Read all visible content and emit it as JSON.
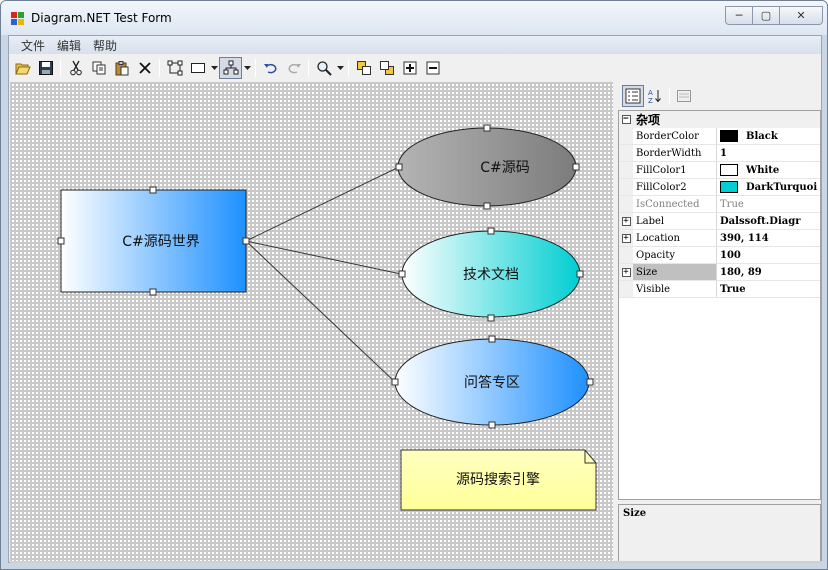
{
  "window": {
    "title": "Diagram.NET Test Form",
    "controls": {
      "minimize": "─",
      "maximize": "▢",
      "close": "✕"
    }
  },
  "menu": {
    "items": [
      "文件",
      "编辑",
      "帮助"
    ]
  },
  "toolbar": {
    "buttons": [
      {
        "icon": "open-folder-icon"
      },
      {
        "icon": "save-icon"
      },
      {
        "icon": "cut-icon"
      },
      {
        "icon": "copy-icon"
      },
      {
        "icon": "paste-icon"
      },
      {
        "icon": "delete-icon"
      },
      {
        "icon": "connector-tool-icon"
      },
      {
        "icon": "rectangle-tool-icon"
      },
      {
        "icon": "auto-layout-icon",
        "pressed": true
      },
      {
        "icon": "undo-icon"
      },
      {
        "icon": "redo-icon"
      },
      {
        "icon": "zoom-icon"
      },
      {
        "icon": "bring-to-front-icon"
      },
      {
        "icon": "send-to-back-icon"
      },
      {
        "icon": "add-icon"
      },
      {
        "icon": "remove-icon"
      }
    ]
  },
  "diagram": {
    "rectangle_label": "C#源码世界",
    "ellipse1_label": "C#源码",
    "ellipse2_label": "技术文档",
    "ellipse3_label": "问答专区",
    "note_label": "源码搜索引擎",
    "colors": {
      "rect_gradient": [
        "#ffffff",
        "#1e90ff"
      ],
      "ellipse1_gradient": [
        "#b4b4b4",
        "#7c7c7c"
      ],
      "ellipse2_gradient": [
        "#ffffff",
        "#00ced1"
      ],
      "ellipse3_gradient": [
        "#ffffff",
        "#1e90ff"
      ],
      "note_gradient": [
        "#ffffc0",
        "#ffff99"
      ]
    }
  },
  "property_grid": {
    "category": "杂项",
    "rows": [
      {
        "name": "BorderColor",
        "value": "Black",
        "swatch": "#000000"
      },
      {
        "name": "BorderWidth",
        "value": "1"
      },
      {
        "name": "FillColor1",
        "value": "White",
        "swatch": "#ffffff"
      },
      {
        "name": "FillColor2",
        "value": "DarkTurquoi",
        "swatch": "#00ced1"
      },
      {
        "name": "IsConnected",
        "value": "True",
        "dim": true
      },
      {
        "name": "Label",
        "value": "Dalssoft.Diagr",
        "expandable": true
      },
      {
        "name": "Location",
        "value": "390, 114",
        "expandable": true
      },
      {
        "name": "Opacity",
        "value": "100"
      },
      {
        "name": "Size",
        "value": "180, 89",
        "expandable": true,
        "selected": true
      },
      {
        "name": "Visible",
        "value": "True"
      }
    ],
    "description": "Size"
  }
}
